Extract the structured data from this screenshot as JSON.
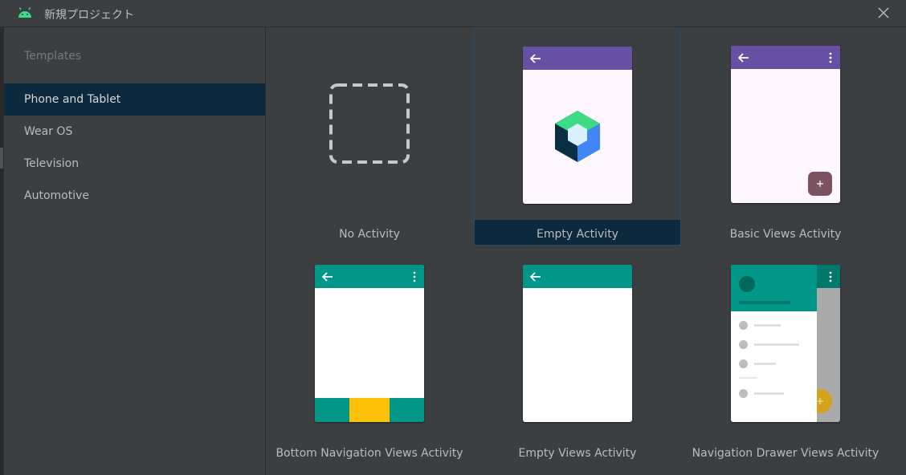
{
  "window": {
    "title": "新規プロジェクト",
    "logo_icon": "android-icon",
    "close_icon": "close-icon"
  },
  "sidebar": {
    "header": "Templates",
    "items": [
      {
        "label": "Phone and Tablet",
        "selected": true
      },
      {
        "label": "Wear OS",
        "selected": false
      },
      {
        "label": "Television",
        "selected": false
      },
      {
        "label": "Automotive",
        "selected": false
      }
    ]
  },
  "templates": [
    {
      "label": "No Activity",
      "selected": false
    },
    {
      "label": "Empty Activity",
      "selected": true
    },
    {
      "label": "Basic Views Activity",
      "selected": false
    },
    {
      "label": "Bottom Navigation Views Activity",
      "selected": false
    },
    {
      "label": "Empty Views Activity",
      "selected": false
    },
    {
      "label": "Navigation Drawer Views Activity",
      "selected": false
    }
  ],
  "colors": {
    "background": "#3c3f41",
    "selection": "#0d293e",
    "purple_appbar": "#6750a4",
    "teal_appbar": "#009688",
    "bottom_nav_highlight": "#ffc107",
    "fab_purple": "#7d5260",
    "fab_yellow": "#d6a21a",
    "android_green": "#3ddc84"
  }
}
